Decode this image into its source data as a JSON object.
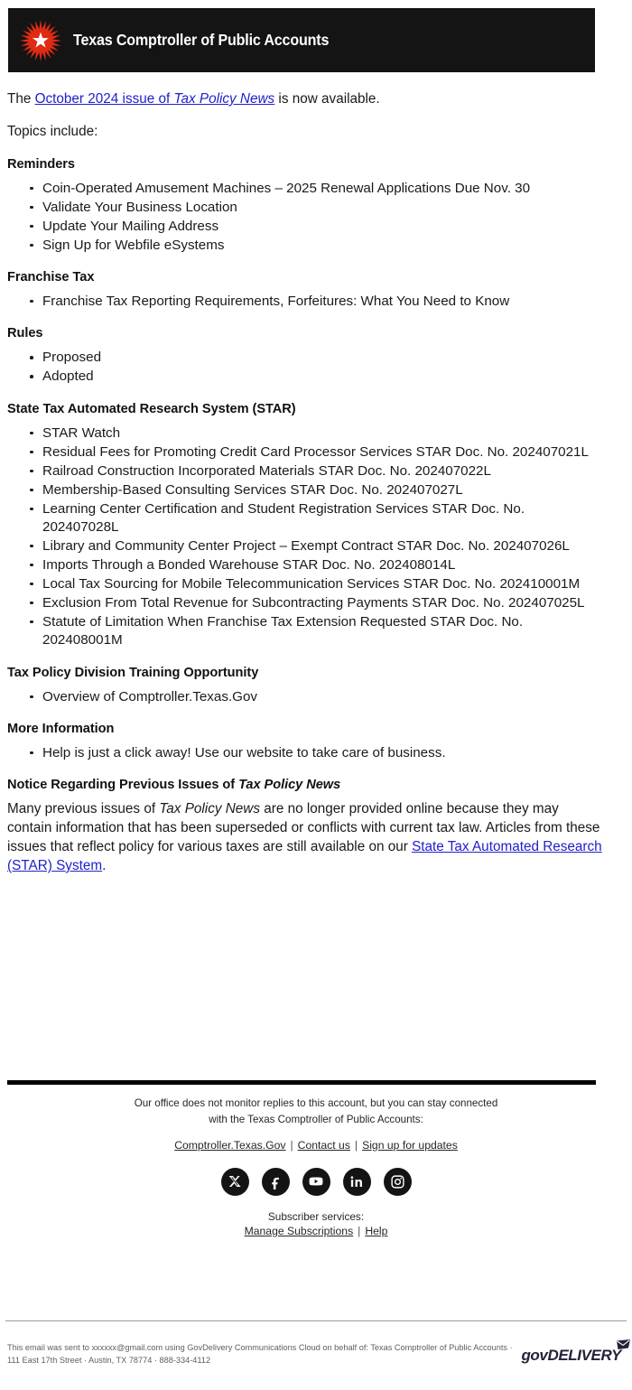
{
  "header": {
    "title": "Texas Comptroller of Public Accounts",
    "logo_icon": "texas-comptroller-starburst-icon",
    "background_color": "#141414"
  },
  "body": {
    "intro_prefix": "The ",
    "intro_link_text": "October 2024 issue of ",
    "intro_link_italic": "Tax Policy News",
    "intro_suffix": " is now available.",
    "topics_line": "Topics include:",
    "link_color": "#2020cc"
  },
  "sections": [
    {
      "heading": "Reminders",
      "items": [
        "Coin-Operated Amusement Machines – 2025 Renewal Applications Due Nov. 30",
        "Validate Your Business Location",
        "Update Your Mailing Address",
        "Sign Up for Webfile eSystems"
      ]
    },
    {
      "heading": "Franchise Tax",
      "items": [
        "Franchise Tax Reporting Requirements, Forfeitures: What You Need to Know"
      ]
    },
    {
      "heading": "Rules",
      "items": [
        "Proposed",
        "Adopted"
      ]
    },
    {
      "heading": "State Tax Automated Research System (STAR)",
      "items": [
        "STAR Watch",
        "Residual Fees for Promoting Credit Card Processor Services STAR Doc. No. 202407021L",
        "Railroad Construction Incorporated Materials STAR Doc. No. 202407022L",
        "Membership-Based Consulting Services STAR Doc. No. 202407027L",
        "Learning Center Certification and Student Registration Services STAR Doc. No. 202407028L",
        "Library and Community Center Project – Exempt Contract STAR Doc. No. 202407026L",
        "Imports Through a Bonded Warehouse STAR Doc. No. 202408014L",
        "Local Tax Sourcing for Mobile Telecommunication Services STAR Doc. No. 202410001M",
        "Exclusion From Total Revenue for Subcontracting Payments STAR Doc. No. 202407025L",
        "Statute of Limitation When Franchise Tax Extension Requested STAR Doc. No. 202408001M"
      ]
    },
    {
      "heading": "Tax Policy Division Training Opportunity",
      "items": [
        "Overview of Comptroller.Texas.Gov"
      ]
    },
    {
      "heading": "More Information",
      "items": [
        "Help is just a click away! Use our website to take care of business."
      ]
    }
  ],
  "notice": {
    "heading_prefix": "Notice Regarding Previous Issues of ",
    "heading_italic": "Tax Policy News",
    "text_part1": "Many previous issues of ",
    "text_italic": "Tax Policy News",
    "text_part2": " are no longer provided online because they may contain information that has been superseded or conflicts with current tax law. Articles from these issues that reflect policy for various taxes are still available on our ",
    "link_text": "State Tax Automated Research (STAR) System",
    "text_part3": "."
  },
  "footer": {
    "note_line1": "Our office does not monitor replies to this account, but you can stay connected",
    "note_line2": "with the Texas Comptroller of Public Accounts:",
    "links": [
      "Comptroller.Texas.Gov",
      "Contact us",
      "Sign up for updates"
    ],
    "separator": "|",
    "social": [
      {
        "name": "x-twitter-icon",
        "label": "X"
      },
      {
        "name": "facebook-icon",
        "label": "Facebook"
      },
      {
        "name": "youtube-icon",
        "label": "YouTube"
      },
      {
        "name": "linkedin-icon",
        "label": "LinkedIn"
      },
      {
        "name": "instagram-icon",
        "label": "Instagram"
      }
    ],
    "subscriber_label": "Subscriber services:",
    "subscriber_links": [
      "Manage Subscriptions",
      "Help"
    ]
  },
  "legal": {
    "line1": "This email was sent to xxxxxx@gmail.com using GovDelivery Communications Cloud on behalf of: Texas Comptroller of Public",
    "line2": "Accounts · 111 East 17th Street · Austin, TX 78774 · 888-334-4112",
    "brand_part1": "gov",
    "brand_part2": "DELIVERY",
    "brand_icon": "envelope-icon"
  }
}
